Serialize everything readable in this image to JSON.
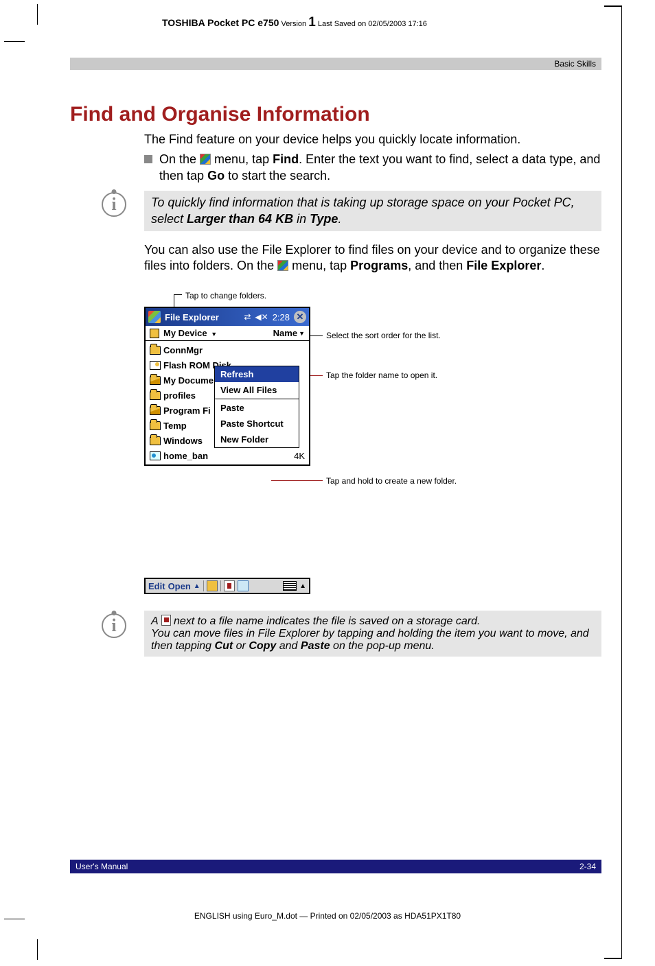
{
  "header": {
    "product": "TOSHIBA Pocket PC e750",
    "version_label": "Version",
    "version": "1",
    "saved": "Last Saved on 02/05/2003 17:16",
    "section": "Basic Skills"
  },
  "title": "Find and Organise Information",
  "para1": "The Find feature on your device helps you quickly locate information.",
  "bullet1_pre": "On the ",
  "bullet1_mid": " menu, tap ",
  "bullet1_find": "Find",
  "bullet1_after": ". Enter the text you want to find, select a data type, and then tap ",
  "bullet1_go": "Go",
  "bullet1_end": " to start the search.",
  "tip1_a": "To quickly find information that is taking up storage space on your Pocket PC, select ",
  "tip1_b": "Larger than 64 KB",
  "tip1_c": " in ",
  "tip1_d": "Type",
  "tip1_e": ".",
  "para2_a": "You can also use the File Explorer to find files on your device and to organize these files into folders. On the ",
  "para2_b": " menu, tap ",
  "para2_programs": "Programs",
  "para2_c": ", and then ",
  "para2_fe": "File Explorer",
  "para2_d": ".",
  "callouts": {
    "tap_change": "Tap to change folders.",
    "sort_order": "Select the sort order for the list.",
    "folder_open": "Tap the folder name to open it.",
    "new_folder": "Tap and hold to create a new folder."
  },
  "ppc": {
    "title": "File Explorer",
    "time": "2:28",
    "device": "My Device",
    "sort": "Name",
    "rows": [
      {
        "icon": "folder",
        "label": "ConnMgr"
      },
      {
        "icon": "card",
        "label": "Flash ROM Disk"
      },
      {
        "icon": "folder-open",
        "label": "My Documents"
      },
      {
        "icon": "folder",
        "label": "profiles"
      },
      {
        "icon": "folder-open",
        "label": "Program Fi"
      },
      {
        "icon": "folder",
        "label": "Temp"
      },
      {
        "icon": "folder",
        "label": "Windows"
      },
      {
        "icon": "image",
        "label": "home_ban",
        "size": "4K"
      }
    ],
    "menu": [
      "Refresh",
      "View All Files",
      "Paste",
      "Paste Shortcut",
      "New Folder"
    ],
    "bottombar": {
      "edit": "Edit",
      "open": "Open"
    }
  },
  "tip2_a": "A ",
  "tip2_b": " next to a file name indicates the file is saved on a storage card.",
  "tip2_c": "You can move files in File Explorer by tapping and holding the item you want to move, and then tapping ",
  "tip2_cut": "Cut",
  "tip2_or": " or ",
  "tip2_copy": "Copy",
  "tip2_and": " and ",
  "tip2_paste": "Paste",
  "tip2_end": " on the pop-up menu.",
  "footer": {
    "manual": "User's Manual",
    "page": "2-34",
    "print": "ENGLISH using Euro_M.dot — Printed on 02/05/2003 as HDA51PX1T80"
  }
}
